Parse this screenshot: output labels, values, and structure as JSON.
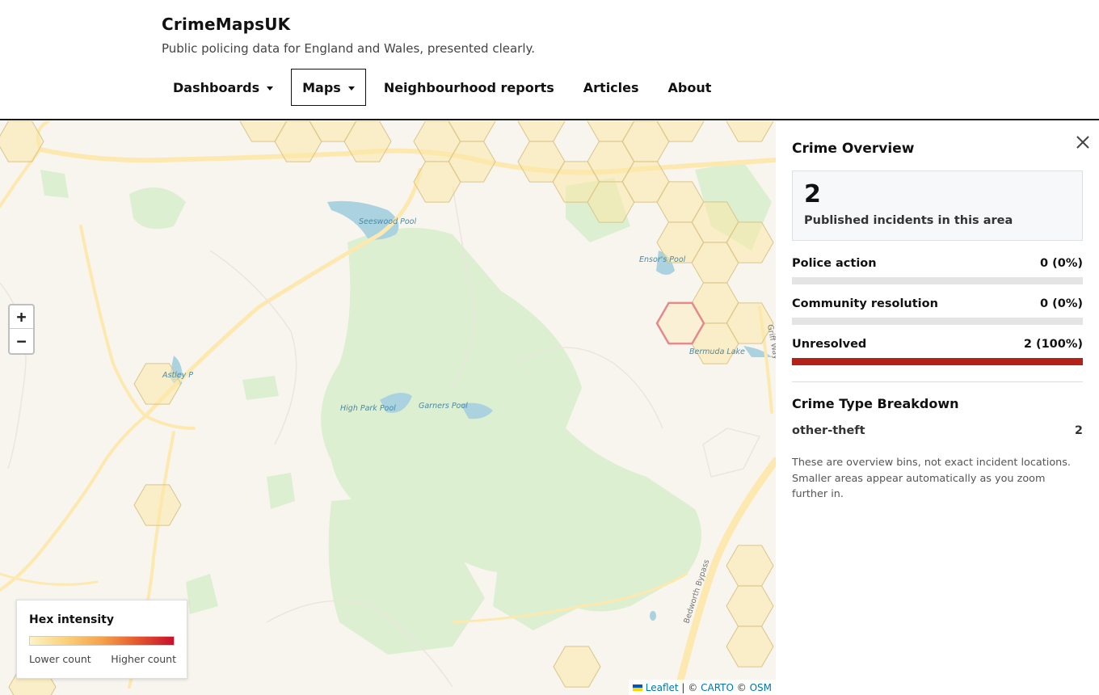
{
  "header": {
    "brand": "CrimeMapsUK",
    "tagline": "Public policing data for England and Wales, presented clearly.",
    "nav": [
      {
        "label": "Dashboards",
        "has_dropdown": true
      },
      {
        "label": "Maps",
        "has_dropdown": true,
        "active": true
      },
      {
        "label": "Neighbourhood reports",
        "has_dropdown": false
      },
      {
        "label": "Articles",
        "has_dropdown": false
      },
      {
        "label": "About",
        "has_dropdown": false
      }
    ]
  },
  "map": {
    "zoom_in": "+",
    "zoom_out": "−",
    "place_labels": [
      "Seeswood Pool",
      "Ensor's Pool",
      "Astley P",
      "High Park Pool",
      "Garners Pool",
      "Bermuda Lake",
      "Bedworth Bypass",
      "Griff Way"
    ],
    "legend": {
      "title": "Hex intensity",
      "low": "Lower count",
      "high": "Higher count"
    },
    "attribution": {
      "leaflet": "Leaflet",
      "sep": " | © ",
      "carto": "CARTO",
      "osm_prefix": " © ",
      "osm": "OSM"
    },
    "colors": {
      "hex_fill": "#fbe7a8",
      "hex_stroke": "#d9c58a",
      "selected_stroke": "#e58a8a",
      "water": "#aad3df",
      "green": "#dcefd0",
      "road": "#fde9b0"
    }
  },
  "panel": {
    "title": "Crime Overview",
    "close_icon": "close-icon",
    "summary": {
      "count": "2",
      "label": "Published incidents in this area"
    },
    "stats": [
      {
        "label": "Police action",
        "value": "0 (0%)",
        "fraction": 0
      },
      {
        "label": "Community resolution",
        "value": "0 (0%)",
        "fraction": 0
      },
      {
        "label": "Unresolved",
        "value": "2 (100%)",
        "fraction": 1
      }
    ],
    "breakdown_title": "Crime Type Breakdown",
    "breakdown": [
      {
        "type": "other-theft",
        "count": "2"
      }
    ],
    "note": "These are overview bins, not exact incident locations. Smaller areas appear automatically as you zoom further in."
  }
}
